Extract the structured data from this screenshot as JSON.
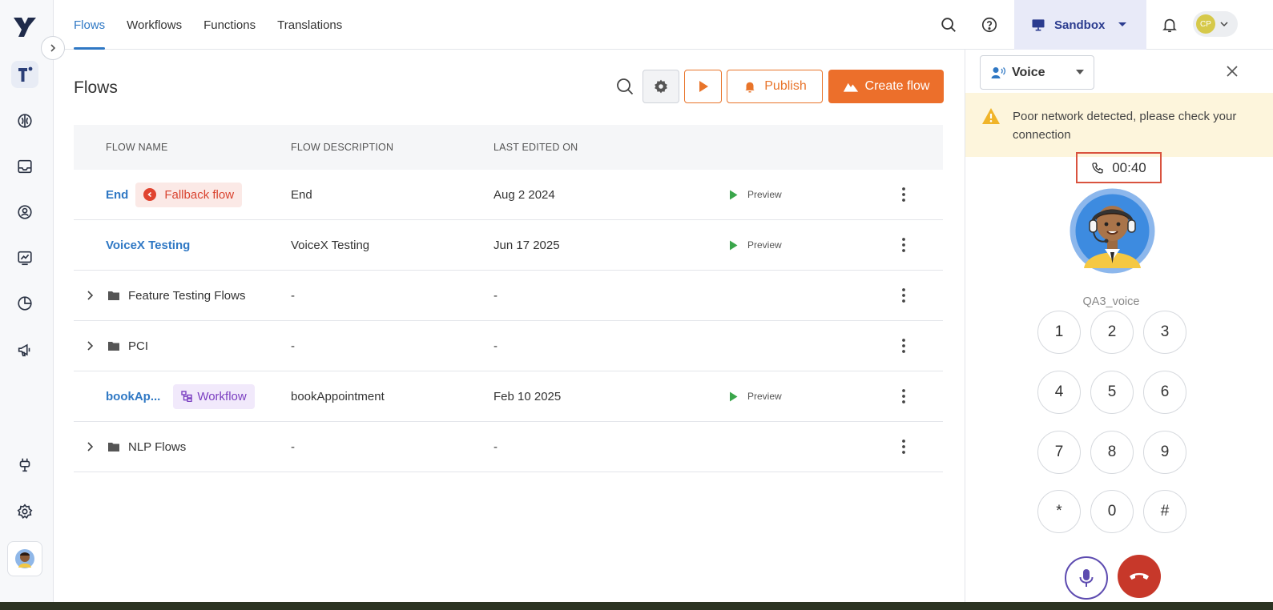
{
  "nav": {
    "tabs": [
      {
        "label": "Flows",
        "active": true
      },
      {
        "label": "Workflows"
      },
      {
        "label": "Functions"
      },
      {
        "label": "Translations"
      }
    ],
    "environment": "Sandbox",
    "user_initials": "CP"
  },
  "rail": {
    "icons": [
      "logo-icon",
      "training-icon",
      "brain-icon",
      "inbox-icon",
      "contacts-icon",
      "analytics-icon",
      "reports-icon",
      "campaign-icon",
      "plug-icon",
      "settings-icon",
      "avatar"
    ]
  },
  "page": {
    "title": "Flows",
    "publish_label": "Publish",
    "create_label": "Create flow"
  },
  "table": {
    "headers": {
      "name": "FLOW NAME",
      "description": "FLOW DESCRIPTION",
      "edited": "LAST EDITED ON"
    },
    "preview_label": "Preview",
    "rows": [
      {
        "name": "End",
        "badge": "Fallback flow",
        "description": "End",
        "edited": "Aug 2 2024"
      },
      {
        "name": "VoiceX Testing",
        "description": "VoiceX Testing",
        "edited": "Jun 17 2025"
      },
      {
        "name": "Feature Testing Flows",
        "description": "-",
        "edited": "-"
      },
      {
        "name": "PCI",
        "description": "-",
        "edited": "-"
      },
      {
        "name": "bookAp...",
        "badge": "Workflow",
        "description": "bookAppointment",
        "edited": "Feb 10 2025"
      },
      {
        "name": "NLP Flows",
        "description": "-",
        "edited": "-"
      }
    ]
  },
  "panel": {
    "channel": "Voice",
    "warning": "Poor network detected, please check your connection",
    "timer": "00:40",
    "agent_name": "QA3_voice",
    "keys": [
      "1",
      "2",
      "3",
      "4",
      "5",
      "6",
      "7",
      "8",
      "9",
      "*",
      "0",
      "#"
    ]
  },
  "colors": {
    "accent_blue": "#2f78c4",
    "brand_orange": "#ec6f2b",
    "fallback_red": "#d9432f",
    "workflow_purple": "#7b3fc1",
    "warning_bg": "#fdf5dc",
    "hangup_red": "#c7382a"
  }
}
